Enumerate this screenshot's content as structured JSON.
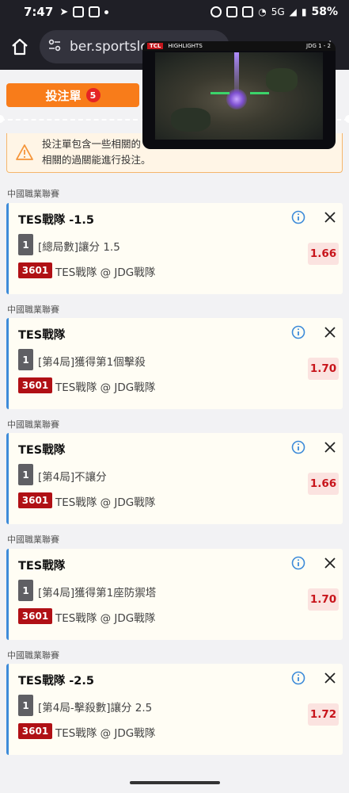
{
  "status_bar": {
    "time": "7:47",
    "battery": "58%",
    "network": "5G"
  },
  "browser": {
    "url_text": "ber.sportslot"
  },
  "video": {
    "brand": "TCL",
    "label": "HIGHLIGHTS",
    "score": "JDG 1 - 2"
  },
  "bet_slip": {
    "tab_label": "投注單",
    "count": "5",
    "warning_line1": "投注單包含一些相關的",
    "warning_line2": "相關的過關能進行投注。"
  },
  "bets": [
    {
      "league": "中國職業聯賽",
      "title": "TES戰隊 -1.5",
      "num": "1",
      "market": "[總局數]讓分 1.5",
      "event_id": "3601",
      "match": "TES戰隊 @ JDG戰隊",
      "odds": "1.66"
    },
    {
      "league": "中國職業聯賽",
      "title": "TES戰隊",
      "num": "1",
      "market": "[第4局]獲得第1個擊殺",
      "event_id": "3601",
      "match": "TES戰隊 @ JDG戰隊",
      "odds": "1.70"
    },
    {
      "league": "中國職業聯賽",
      "title": "TES戰隊",
      "num": "1",
      "market": "[第4局]不讓分",
      "event_id": "3601",
      "match": "TES戰隊 @ JDG戰隊",
      "odds": "1.66"
    },
    {
      "league": "中國職業聯賽",
      "title": "TES戰隊",
      "num": "1",
      "market": "[第4局]獲得第1座防禦塔",
      "event_id": "3601",
      "match": "TES戰隊 @ JDG戰隊",
      "odds": "1.70"
    },
    {
      "league": "中國職業聯賽",
      "title": "TES戰隊 -2.5",
      "num": "1",
      "market": "[第4局-擊殺數]讓分 2.5",
      "event_id": "3601",
      "match": "TES戰隊 @ JDG戰隊",
      "odds": "1.72"
    }
  ],
  "colors": {
    "accent_orange": "#f87c1a",
    "odds_red": "#c8151b",
    "card_border_blue": "#3d8bd9"
  }
}
